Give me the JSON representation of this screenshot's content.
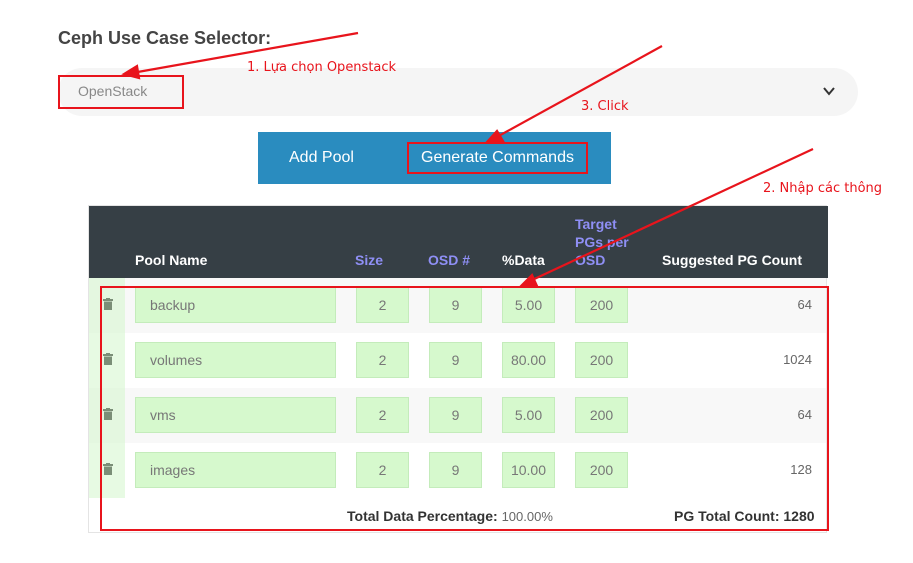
{
  "title": "Ceph Use Case Selector:",
  "selector": {
    "value": "OpenStack"
  },
  "buttons": {
    "add_pool": "Add Pool",
    "generate": "Generate Commands"
  },
  "table": {
    "headers": {
      "pool_name": "Pool Name",
      "size": "Size",
      "osd": "OSD #",
      "data": "%Data",
      "target": "Target PGs per OSD",
      "suggested": "Suggested PG Count"
    },
    "rows": [
      {
        "name": "backup",
        "size": "2",
        "osd": "9",
        "data": "5.00",
        "target": "200",
        "pg": "64"
      },
      {
        "name": "volumes",
        "size": "2",
        "osd": "9",
        "data": "80.00",
        "target": "200",
        "pg": "1024"
      },
      {
        "name": "vms",
        "size": "2",
        "osd": "9",
        "data": "5.00",
        "target": "200",
        "pg": "64"
      },
      {
        "name": "images",
        "size": "2",
        "osd": "9",
        "data": "10.00",
        "target": "200",
        "pg": "128"
      }
    ],
    "footer": {
      "total_data_label": "Total Data Percentage:",
      "total_data_value": "100.00%",
      "pg_total_label": "PG Total Count:",
      "pg_total_value": "1280"
    }
  },
  "annotations": {
    "step1": "1. Lựa chọn Openstack",
    "step2": "2. Nhập các thông",
    "step3": "3. Click",
    "color": "#e8141c"
  },
  "colors": {
    "button_bar": "#2a8cbf",
    "table_header": "#363f45",
    "header_accent": "#8f8ff5",
    "input_bg": "#d6f9cd"
  }
}
